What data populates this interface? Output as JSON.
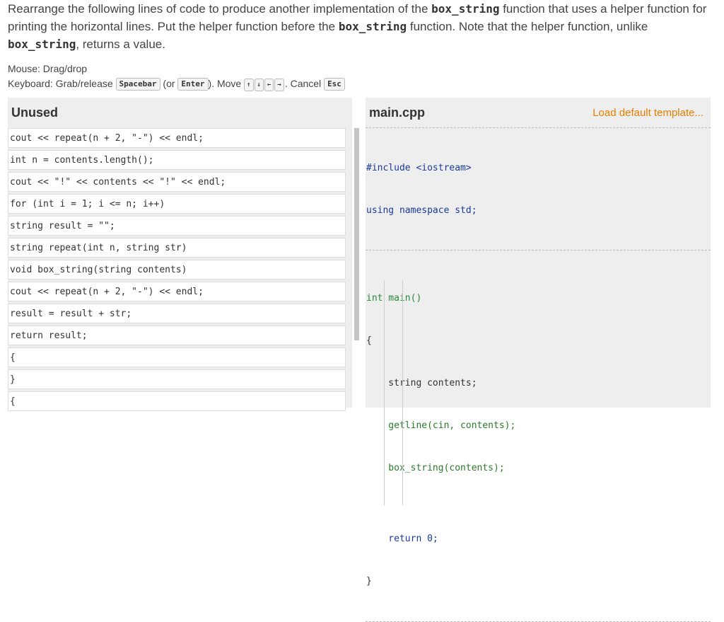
{
  "instructions": {
    "part1": "Rearrange the following lines of code to produce another implementation of the ",
    "code1": "box_string",
    "part2": " function that uses a helper function for printing the horizontal lines. Put the helper function before the ",
    "code2": "box_string",
    "part3": " function. Note that the helper function, unlike ",
    "code3": "box_string",
    "part4": ", returns a value."
  },
  "help": {
    "mouse": "Mouse: Drag/drop",
    "keyboard_prefix": "Keyboard: Grab/release",
    "spacebar": "Spacebar",
    "or_open": "(or",
    "enter": "Enter",
    "move_text": "). Move",
    "arrow_up": "↑",
    "arrow_down": "↓",
    "arrow_left": "←",
    "arrow_right": "→",
    "cancel_text": ". Cancel",
    "esc": "Esc"
  },
  "unused": {
    "title": "Unused",
    "blocks": [
      "cout << repeat(n + 2, \"-\") << endl;",
      "int n = contents.length();",
      "cout << \"!\" << contents << \"!\" << endl;",
      "for (int i = 1; i <= n; i++)",
      "string result = \"\";",
      "string repeat(int n, string str)",
      "void box_string(string contents)",
      "cout << repeat(n + 2, \"-\") << endl;",
      "result = result + str;",
      "return result;",
      "{",
      "}",
      "{"
    ]
  },
  "editor": {
    "file_name": "main.cpp",
    "load_default": "Load default template...",
    "top_lines": [
      "#include <iostream>",
      "using namespace std;"
    ],
    "main_lines": [
      "int main()",
      "{",
      "    string contents;",
      "    getline(cin, contents);",
      "    box_string(contents);",
      "",
      "    return 0;",
      "}"
    ]
  }
}
